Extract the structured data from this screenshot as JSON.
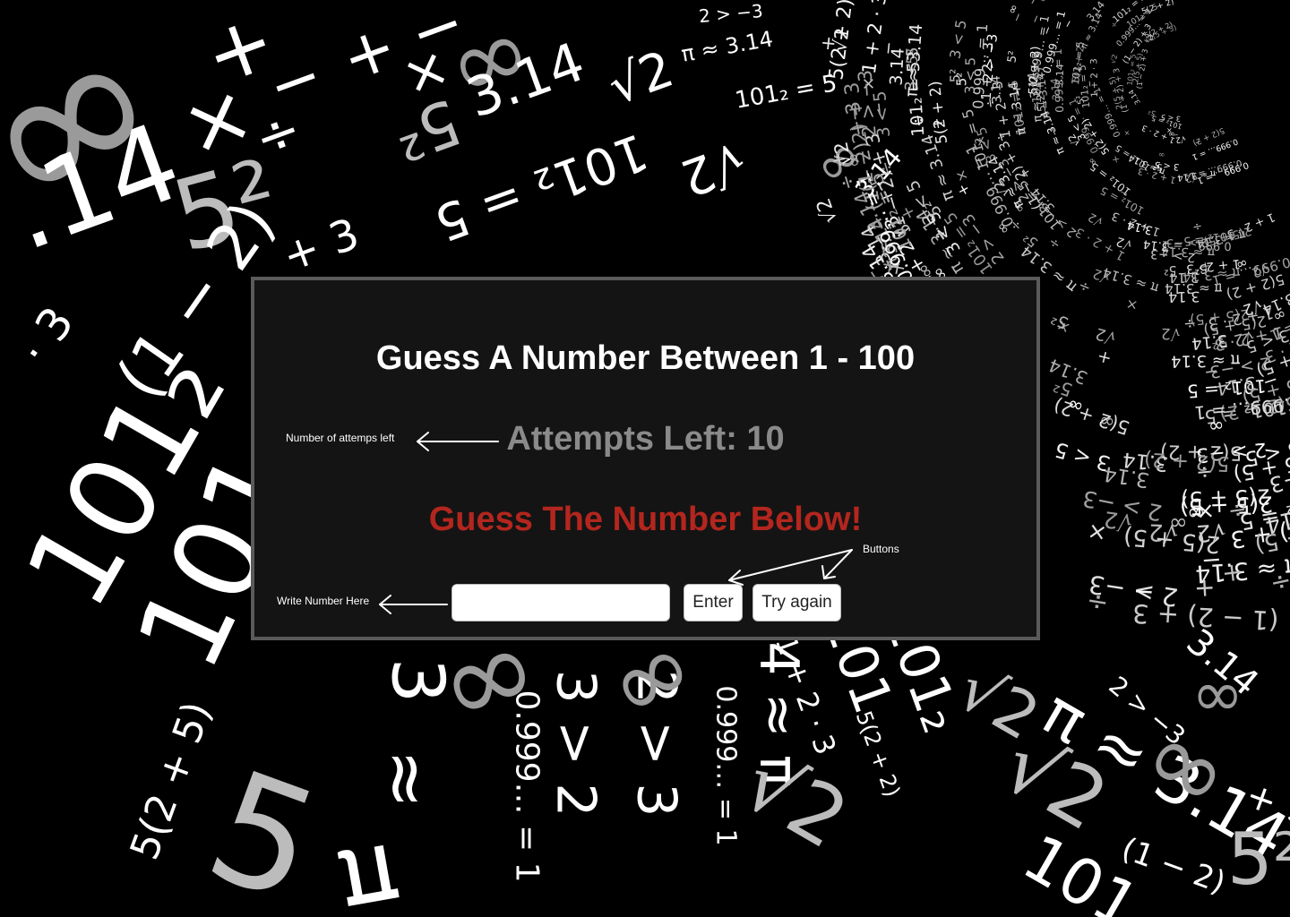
{
  "game": {
    "title": "Guess A Number Between 1 - 100",
    "attempts_label": "Attempts Left: 10",
    "message": "Guess The Number Below!",
    "message_color": "#b3261e",
    "input_value": "",
    "input_placeholder": "",
    "enter_label": "Enter",
    "try_again_label": "Try again"
  },
  "annotations": {
    "attempts_note": "Number of attemps left",
    "buttons_note": "Buttons",
    "input_note": "Write Number Here"
  },
  "background": {
    "theme": "math-symbols",
    "symbols": [
      "∞",
      "3.14",
      "5²",
      "101₂ = 5",
      "π ≈ 3.14",
      "√2",
      "(1 − 2) + 3",
      "2 > −3",
      "0.999… = 1",
      "5(2 + 2)",
      "2(5 + 5)",
      "1 + 2 · 3",
      "+",
      "−",
      "×",
      "÷",
      "3 < 5"
    ]
  }
}
